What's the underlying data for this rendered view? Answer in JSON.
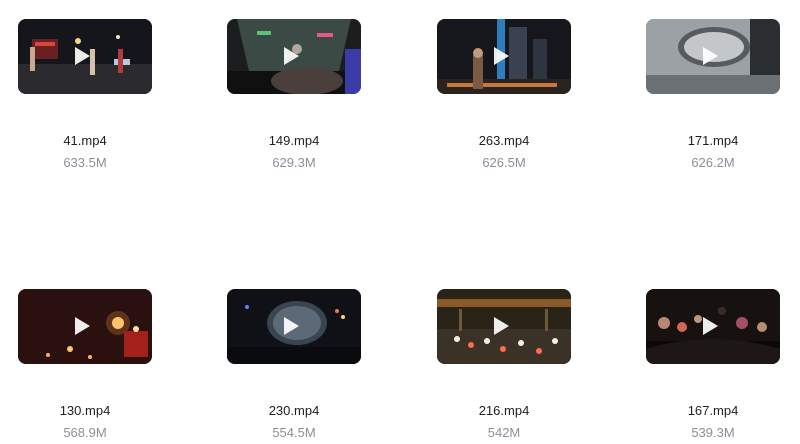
{
  "videos": [
    {
      "name": "41.mp4",
      "size": "633.5M",
      "thumb": "night-street-dancers"
    },
    {
      "name": "149.mp4",
      "size": "629.3M",
      "thumb": "car-windshield-night-road"
    },
    {
      "name": "263.mp4",
      "size": "626.5M",
      "thumb": "city-skyscraper-night-person"
    },
    {
      "name": "171.mp4",
      "size": "626.2M",
      "thumb": "rainy-side-mirror"
    },
    {
      "name": "130.mp4",
      "size": "568.9M",
      "thumb": "candles-dark"
    },
    {
      "name": "230.mp4",
      "size": "554.5M",
      "thumb": "rainy-mirror-night"
    },
    {
      "name": "216.mp4",
      "size": "542M",
      "thumb": "city-traffic-jam-night"
    },
    {
      "name": "167.mp4",
      "size": "539.3M",
      "thumb": "car-dashboard-bokeh"
    }
  ]
}
